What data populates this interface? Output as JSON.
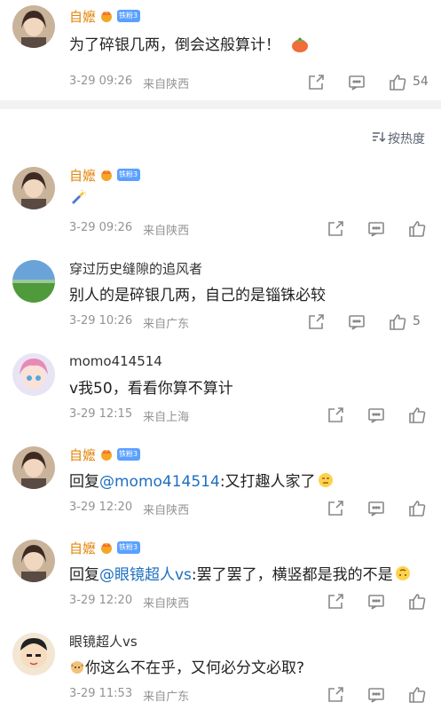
{
  "top_comment": {
    "name": "自嬷",
    "fan_badge": "铁粉3",
    "text": "为了碎银几两，倒会这般算计！",
    "time": "3-29 09:26",
    "location": "来自陕西",
    "likes": "54"
  },
  "sort": {
    "label": "按热度"
  },
  "replies": [
    {
      "name": "自嬷",
      "fan_badge": "铁粉3",
      "name_color": "orange",
      "text": "",
      "emoji": "flashlight",
      "time": "3-29 09:26",
      "location": "来自陕西",
      "likes": ""
    },
    {
      "name": "穿过历史缝隙的追风者",
      "name_color": "gray",
      "text": "别人的是碎银几两，自己的是锱铢必较",
      "time": "3-29 10:26",
      "location": "来自广东",
      "likes": "5"
    },
    {
      "name": "momo414514",
      "name_color": "gray",
      "text": "v我50，看看你算不算计",
      "time": "3-29 12:15",
      "location": "来自上海",
      "likes": ""
    },
    {
      "name": "自嬷",
      "fan_badge": "铁粉3",
      "name_color": "orange",
      "reply_prefix": "回复",
      "mention": "@momo414514",
      "text": ":又打趣人家了",
      "time": "3-29 12:20",
      "location": "来自陕西",
      "likes": ""
    },
    {
      "name": "自嬷",
      "fan_badge": "铁粉3",
      "name_color": "orange",
      "reply_prefix": "回复",
      "mention": "@眼镜超人vs",
      "text": ":罢了罢了，横竖都是我的不是",
      "time": "3-29 12:20",
      "location": "来自陕西",
      "likes": ""
    },
    {
      "name": "眼镜超人vs",
      "name_color": "gray",
      "text": "你这么不在乎，又何必分文必取?",
      "time": "3-29 11:53",
      "location": "来自广东",
      "likes": ""
    }
  ],
  "colors": {
    "orange": "#e3860c",
    "mention": "#1e6fbf",
    "meta": "#939393",
    "badge": "#5aa0ff"
  }
}
